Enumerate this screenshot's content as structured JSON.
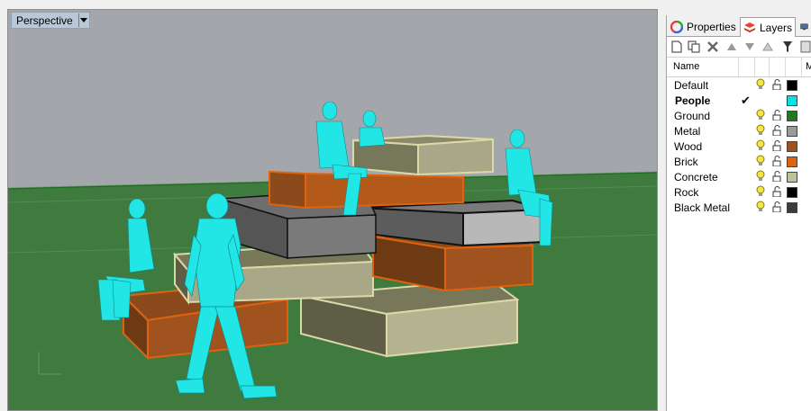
{
  "viewport": {
    "title": "Perspective",
    "colors": {
      "sky": "#a3a7ac",
      "ground": "#3f7a3f",
      "people": "#22e6e6"
    }
  },
  "panel": {
    "tabs": [
      {
        "label": "Properties",
        "icon": "properties-icon"
      },
      {
        "label": "Layers",
        "icon": "layers-icon"
      },
      {
        "label": "",
        "icon": "display-icon"
      }
    ],
    "toolbar": [
      "new-layer-icon",
      "new-sublayer-icon",
      "delete-icon",
      "move-up-icon",
      "move-down-icon",
      "move-to-parent-icon",
      "filter-icon",
      "tools-icon"
    ],
    "columns": {
      "name": "Name",
      "m": "M"
    },
    "layers": [
      {
        "name": "Default",
        "color": "#000000",
        "current": false
      },
      {
        "name": "People",
        "color": "#00e5e5",
        "current": true
      },
      {
        "name": "Ground",
        "color": "#1f7a1f",
        "current": false
      },
      {
        "name": "Metal",
        "color": "#9a9a9a",
        "current": false
      },
      {
        "name": "Wood",
        "color": "#a0531e",
        "current": false
      },
      {
        "name": "Brick",
        "color": "#e0620e",
        "current": false
      },
      {
        "name": "Concrete",
        "color": "#c0c09a",
        "current": false
      },
      {
        "name": "Rock",
        "color": "#000000",
        "current": false
      },
      {
        "name": "Black Metal",
        "color": "#3c3c3c",
        "current": false
      }
    ]
  }
}
